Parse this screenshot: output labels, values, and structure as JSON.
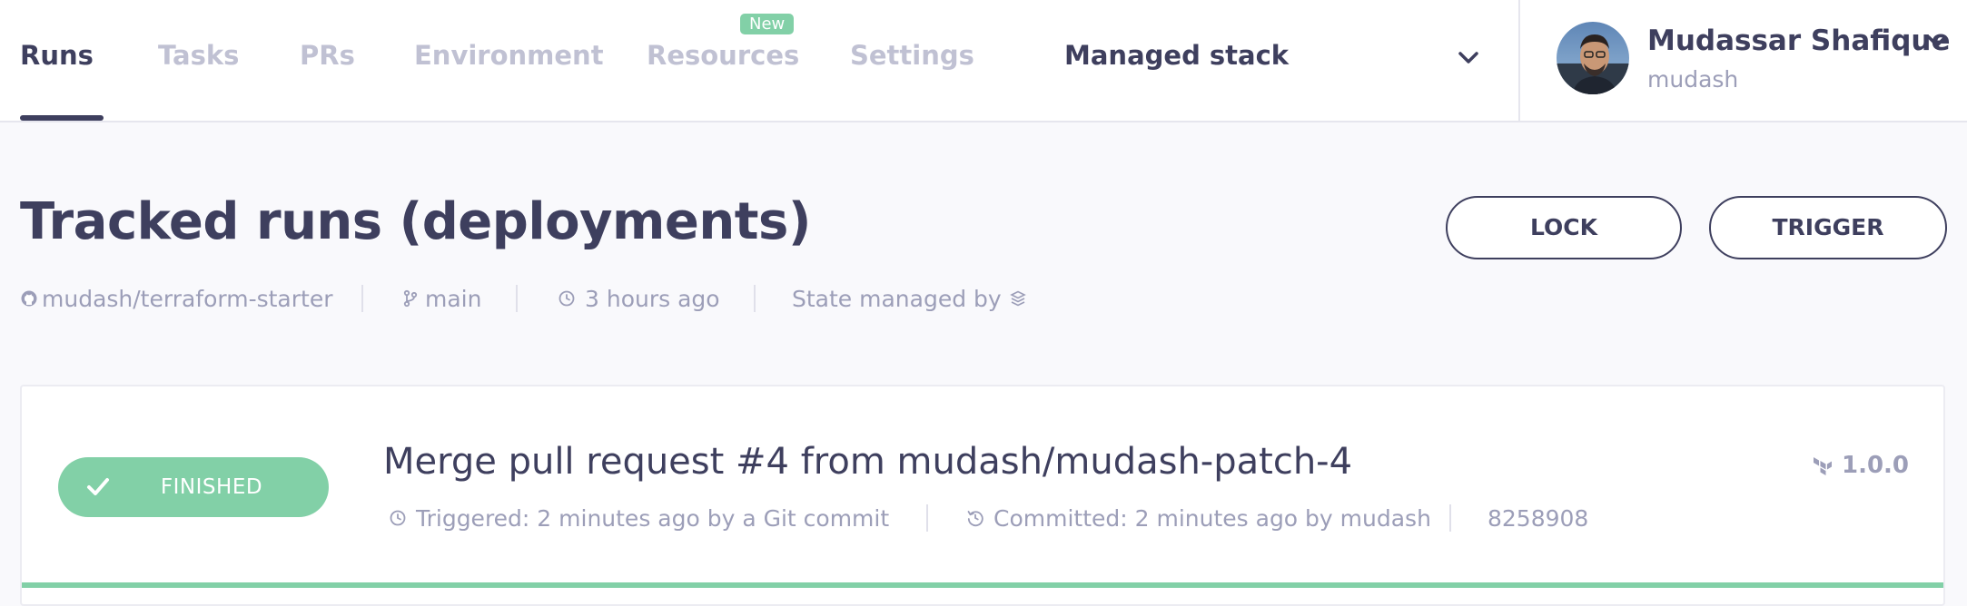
{
  "nav": {
    "tabs": [
      {
        "label": "Runs",
        "active": true
      },
      {
        "label": "Tasks",
        "active": false
      },
      {
        "label": "PRs",
        "active": false
      },
      {
        "label": "Environment",
        "active": false
      },
      {
        "label": "Resources",
        "active": false,
        "badge": "New"
      },
      {
        "label": "Settings",
        "active": false
      }
    ],
    "stack_selector": {
      "label": "Managed stack",
      "icon": "chevron-down-icon"
    },
    "user": {
      "name": "Mudassar Shafique",
      "handle": "mudash",
      "icon": "chevron-down-icon"
    }
  },
  "page": {
    "title": "Tracked runs (deployments)",
    "actions": {
      "lock_label": "LOCK",
      "trigger_label": "TRIGGER"
    },
    "meta": {
      "repo": "mudash/terraform-starter",
      "branch": "main",
      "updated": "3 hours ago",
      "state_managed_by": "State managed by"
    }
  },
  "runs": [
    {
      "status": "FINISHED",
      "title": "Merge pull request #4 from mudash/mudash-patch-4",
      "triggered": "Triggered: 2 minutes ago by a Git commit",
      "committed": "Committed: 2 minutes ago by mudash",
      "commit_sha": "8258908",
      "version": "1.0.0"
    }
  ],
  "colors": {
    "text_primary": "#3e3f5e",
    "text_muted": "#9c9eb8",
    "tab_inactive": "#c0c1d3",
    "success": "#82d0a7",
    "background": "#f9f9fc"
  }
}
